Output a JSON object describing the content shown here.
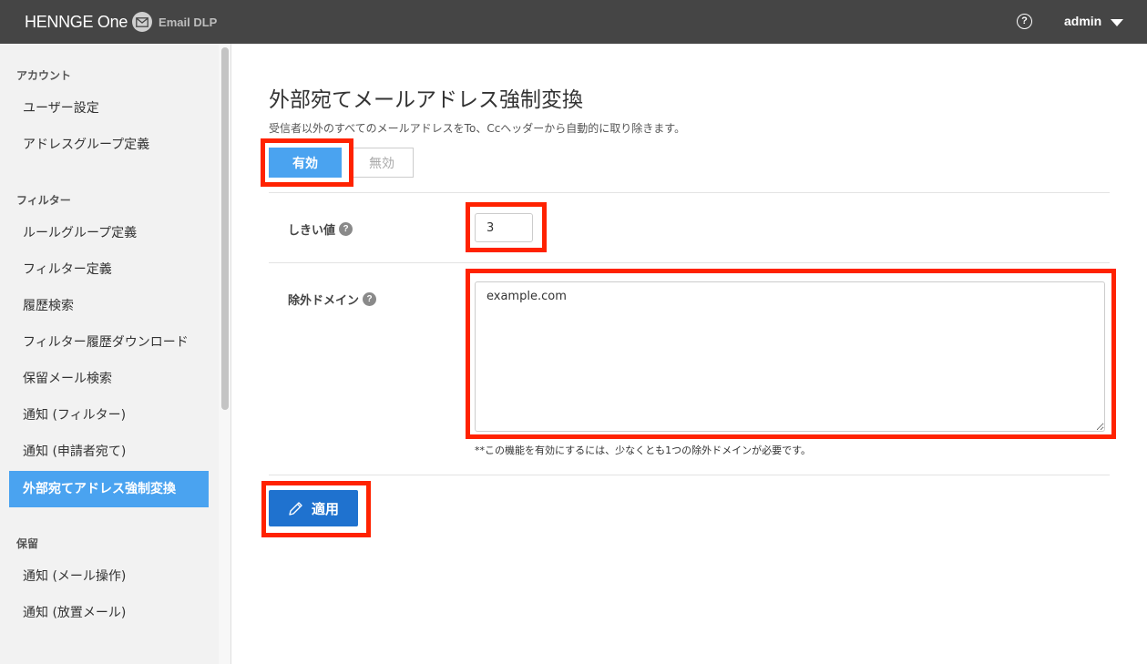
{
  "header": {
    "brand": "HENNGE One",
    "product": "Email DLP",
    "help_glyph": "?",
    "user": "admin"
  },
  "sidebar": {
    "sections": [
      {
        "label": "アカウント",
        "items": [
          "ユーザー設定",
          "アドレスグループ定義"
        ]
      },
      {
        "label": "フィルター",
        "items": [
          "ルールグループ定義",
          "フィルター定義",
          "履歴検索",
          "フィルター履歴ダウンロード",
          "保留メール検索",
          "通知 (フィルター)",
          "通知 (申請者宛て)",
          "外部宛てアドレス強制変換"
        ]
      },
      {
        "label": "保留",
        "items": [
          "通知 (メール操作)",
          "通知 (放置メール)"
        ]
      }
    ],
    "active_item": "外部宛てアドレス強制変換"
  },
  "main": {
    "title": "外部宛てメールアドレス強制変換",
    "description": "受信者以外のすべてのメールアドレスをTo、Ccヘッダーから自動的に取り除きます。",
    "toggle": {
      "on_label": "有効",
      "off_label": "無効",
      "selected": "有効"
    },
    "threshold": {
      "label": "しきい値",
      "value": "3"
    },
    "exclude_domains": {
      "label": "除外ドメイン",
      "value": "example.com"
    },
    "note": "**この機能を有効にするには、少なくとも1つの除外ドメインが必要です。",
    "apply_label": "適用"
  },
  "colors": {
    "header_bg": "#454545",
    "sidebar_bg": "#f2f2f2",
    "active_item": "#4aa3f0",
    "primary_button": "#1f72cf",
    "highlight": "#ff2200"
  }
}
